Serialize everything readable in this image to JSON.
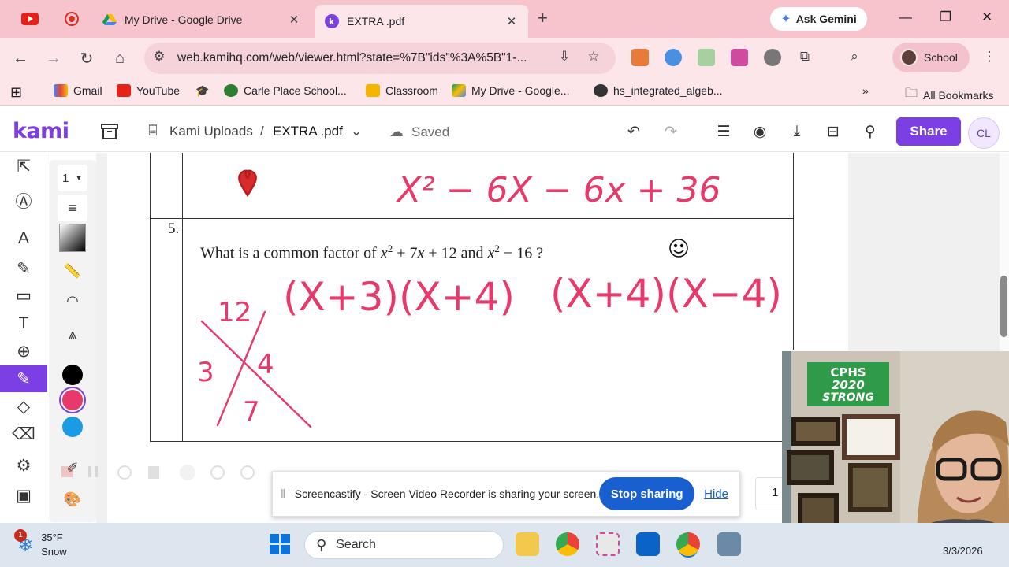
{
  "browser": {
    "tabs": [
      {
        "title": "My Drive - Google Drive",
        "active": false
      },
      {
        "title": "EXTRA .pdf",
        "active": true
      }
    ],
    "ask_gemini": "Ask Gemini",
    "url": "web.kamihq.com/web/viewer.html?state=%7B\"ids\"%3A%5B\"1-...",
    "profile_label": "School",
    "bookmarks": [
      "Gmail",
      "YouTube",
      "Carle Place School...",
      "Classroom",
      "My Drive - Google...",
      "hs_integrated_algeb..."
    ],
    "all_bookmarks": "All Bookmarks"
  },
  "kami": {
    "logo": "kami",
    "breadcrumb_folder": "Kami Uploads",
    "breadcrumb_sep": "/",
    "file_name": "EXTRA .pdf",
    "save_status": "Saved",
    "share_label": "Share",
    "user_initials": "CL",
    "size_value": "1"
  },
  "colors": {
    "brand": "#7b3fe4",
    "tab_strip": "#f7c4cd",
    "ink_pink": "#e8396b",
    "swatch_black": "#000000",
    "swatch_pink": "#e8396b",
    "swatch_blue": "#1a9be6"
  },
  "document": {
    "question_number": "5.",
    "question_prefix": "What is a common factor of ",
    "var1": "x",
    "exp1": "2",
    "mid1": " + 7",
    "var2": "x",
    "mid2": " + 12 and ",
    "var3": "x",
    "exp2": "2",
    "mid3": " − 16 ?",
    "handwriting_top": "X² − 6X − 6x + 36",
    "handwriting_factors1": "(X+3)(X+4)",
    "handwriting_factors2": "(X+4)(X−4)",
    "x_box_top": "12",
    "x_box_left": "3",
    "x_box_right": "4",
    "x_box_bottom": "7"
  },
  "banner": {
    "text": "Screencastify - Screen Video Recorder is sharing your screen.",
    "stop_label": "Stop sharing",
    "hide_label": "Hide",
    "page_number": "1"
  },
  "webcam": {
    "sign_line1": "CPHS",
    "sign_line2": "2020",
    "sign_line3": "STRONG"
  },
  "taskbar": {
    "temperature": "35°F",
    "condition": "Snow",
    "notification_count": "1",
    "search_placeholder": "Search",
    "date": "3/3/2026"
  }
}
